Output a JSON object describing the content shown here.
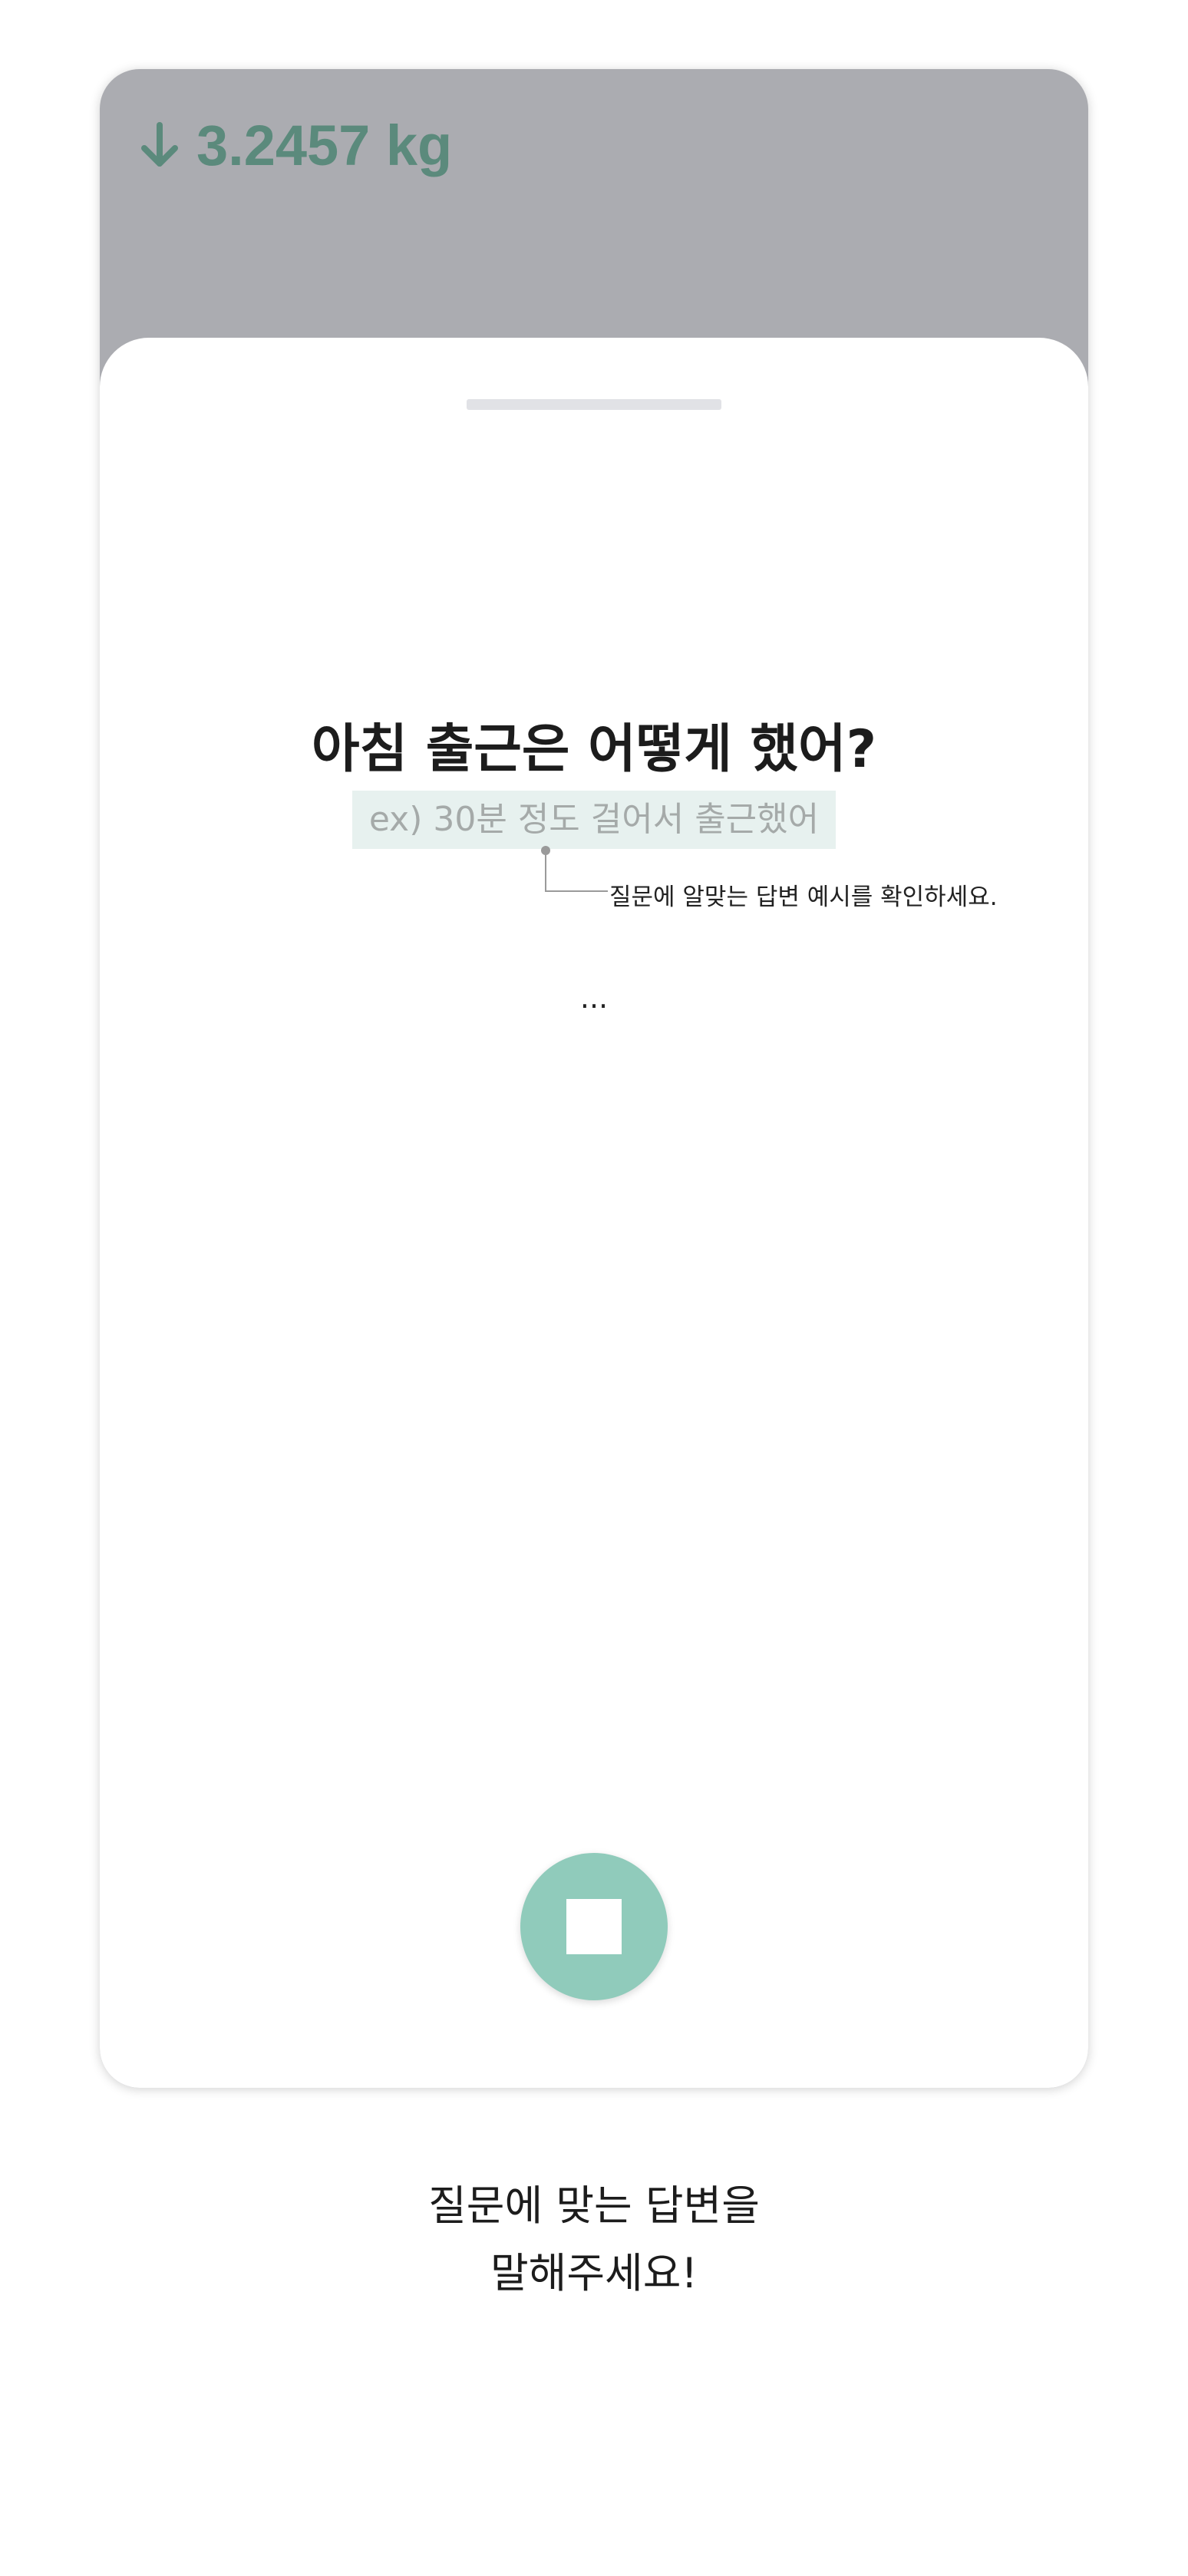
{
  "stat": {
    "icon": "arrow-down-icon",
    "value": "3.2457 kg",
    "color": "#5b8a7c"
  },
  "sheet": {
    "question": "아침 출근은 어떻게 했어?",
    "example": "ex) 30분 정도 걸어서 출근했어",
    "hint": "질문에 알맞는 답변 예시를 확인하세요.",
    "status": "...",
    "record_button": {
      "icon": "stop-icon",
      "color": "#90cbbb"
    }
  },
  "footer": {
    "line1": "질문에 맞는 답변을",
    "line2": "말해주세요!"
  }
}
